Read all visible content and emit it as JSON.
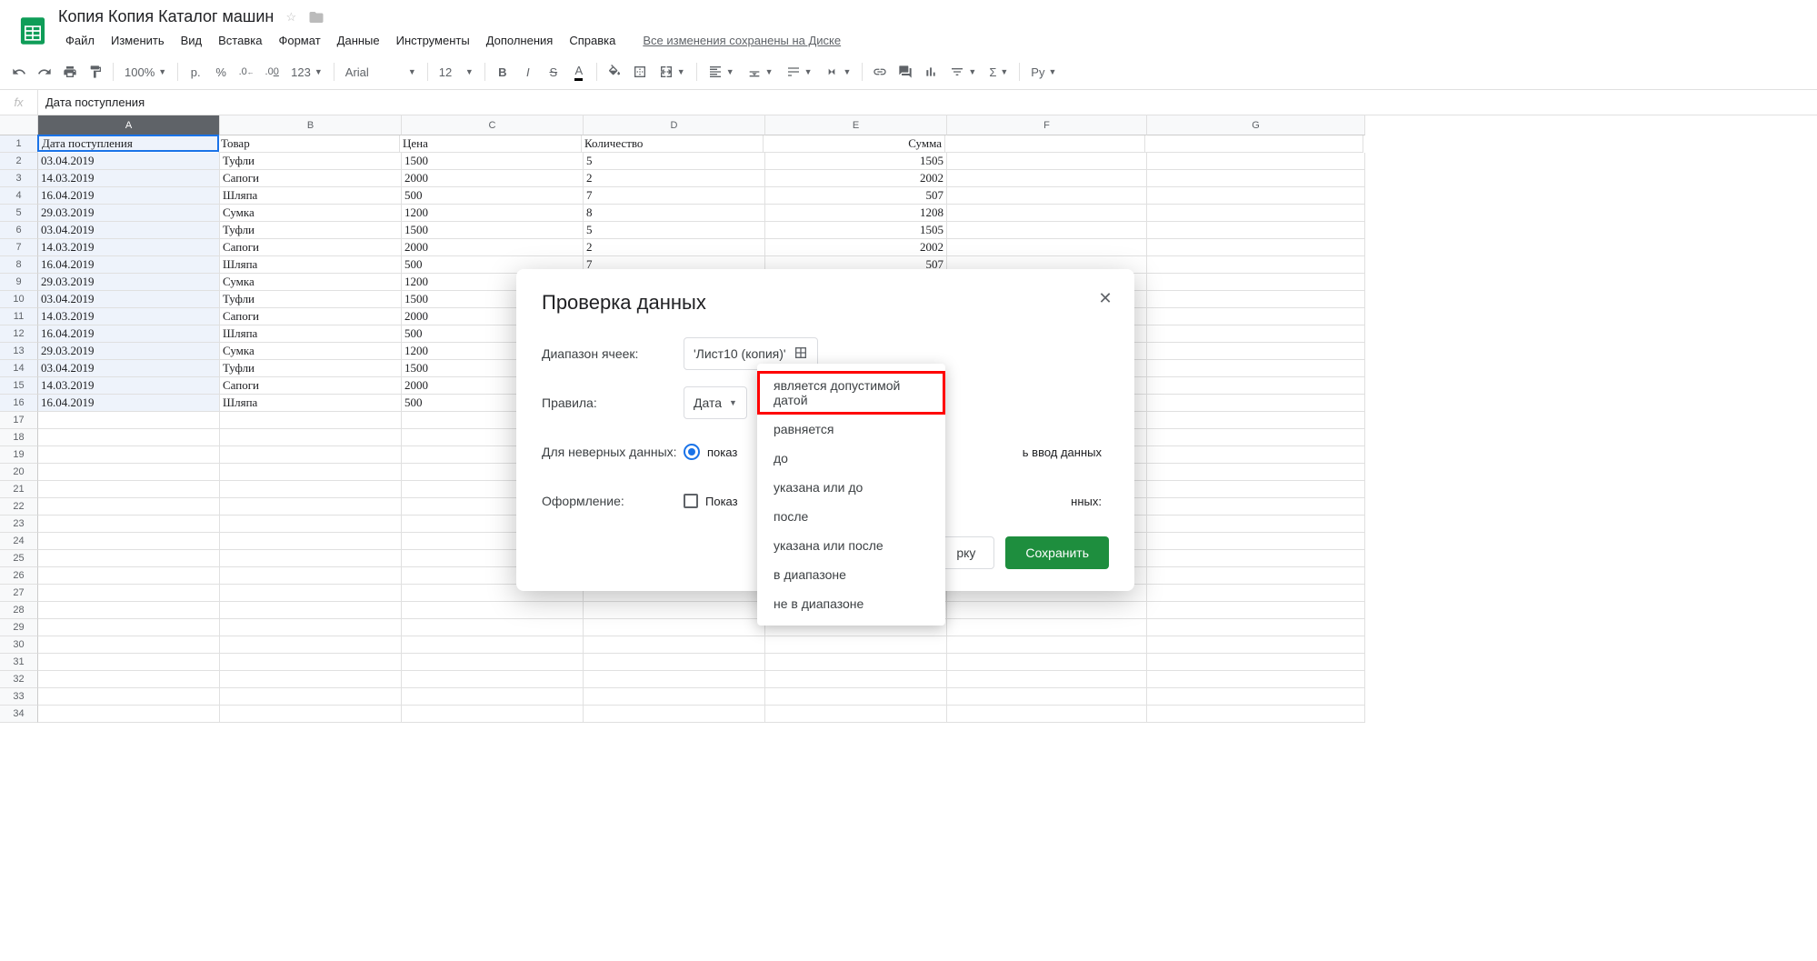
{
  "doc": {
    "title": "Копия Копия Каталог машин",
    "saved_msg": "Все изменения сохранены на Диске"
  },
  "menu": [
    "Файл",
    "Изменить",
    "Вид",
    "Вставка",
    "Формат",
    "Данные",
    "Инструменты",
    "Дополнения",
    "Справка"
  ],
  "toolbar": {
    "zoom": "100%",
    "currency": "р.",
    "percent": "%",
    "dec_less": ".0",
    "dec_more": ".00",
    "num_format": "123",
    "font": "Arial",
    "font_size": "12",
    "language": "Ру"
  },
  "formula_bar": {
    "fx": "fx",
    "value": "Дата поступления"
  },
  "columns": [
    "A",
    "B",
    "C",
    "D",
    "E",
    "F",
    "G"
  ],
  "rows": [
    {
      "n": 1,
      "A": "Дата поступления",
      "B": "Товар",
      "C": "Цена",
      "D": "Количество",
      "E": "Сумма"
    },
    {
      "n": 2,
      "A": "03.04.2019",
      "B": "Туфли",
      "C": "1500",
      "D": "5",
      "E": "1505"
    },
    {
      "n": 3,
      "A": "14.03.2019",
      "B": "Сапоги",
      "C": "2000",
      "D": "2",
      "E": "2002"
    },
    {
      "n": 4,
      "A": "16.04.2019",
      "B": "Шляпа",
      "C": "500",
      "D": "7",
      "E": "507"
    },
    {
      "n": 5,
      "A": "29.03.2019",
      "B": "Сумка",
      "C": "1200",
      "D": "8",
      "E": "1208"
    },
    {
      "n": 6,
      "A": "03.04.2019",
      "B": "Туфли",
      "C": "1500",
      "D": "5",
      "E": "1505"
    },
    {
      "n": 7,
      "A": "14.03.2019",
      "B": "Сапоги",
      "C": "2000",
      "D": "2",
      "E": "2002"
    },
    {
      "n": 8,
      "A": "16.04.2019",
      "B": "Шляпа",
      "C": "500",
      "D": "7",
      "E": "507"
    },
    {
      "n": 9,
      "A": "29.03.2019",
      "B": "Сумка",
      "C": "1200"
    },
    {
      "n": 10,
      "A": "03.04.2019",
      "B": "Туфли",
      "C": "1500"
    },
    {
      "n": 11,
      "A": "14.03.2019",
      "B": "Сапоги",
      "C": "2000"
    },
    {
      "n": 12,
      "A": "16.04.2019",
      "B": "Шляпа",
      "C": "500"
    },
    {
      "n": 13,
      "A": "29.03.2019",
      "B": "Сумка",
      "C": "1200"
    },
    {
      "n": 14,
      "A": "03.04.2019",
      "B": "Туфли",
      "C": "1500"
    },
    {
      "n": 15,
      "A": "14.03.2019",
      "B": "Сапоги",
      "C": "2000"
    },
    {
      "n": 16,
      "A": "16.04.2019",
      "B": "Шляпа",
      "C": "500"
    },
    {
      "n": 17
    },
    {
      "n": 18
    },
    {
      "n": 19
    },
    {
      "n": 20
    },
    {
      "n": 21
    },
    {
      "n": 22
    },
    {
      "n": 23
    },
    {
      "n": 24
    },
    {
      "n": 25
    },
    {
      "n": 26
    },
    {
      "n": 27
    },
    {
      "n": 28
    },
    {
      "n": 29
    },
    {
      "n": 30
    },
    {
      "n": 31
    },
    {
      "n": 32
    },
    {
      "n": 33
    },
    {
      "n": 34
    }
  ],
  "dialog": {
    "title": "Проверка данных",
    "range_label": "Диапазон ячеек:",
    "range_value": "'Лист10 (копия)'",
    "rules_label": "Правила:",
    "rule_type": "Дата",
    "invalid_label": "Для неверных данных:",
    "invalid_option1": "показ",
    "invalid_option2_tail": "ь ввод данных",
    "appearance_label": "Оформление:",
    "appearance_checkbox": "Показ",
    "appearance_tail": "нных:",
    "btn_remove_tail": "рку",
    "btn_save": "Сохранить"
  },
  "dropdown": {
    "options": [
      "является допустимой датой",
      "равняется",
      "до",
      "указана или до",
      "после",
      "указана или после",
      "в диапазоне",
      "не в диапазоне"
    ]
  }
}
